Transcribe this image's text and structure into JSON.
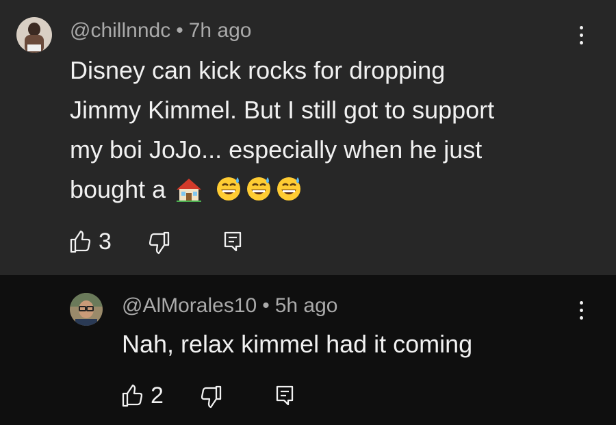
{
  "comments": [
    {
      "handle": "@chillnndc",
      "time": "7h ago",
      "text_lines": [
        "Disney can kick rocks for dropping",
        "Jimmy Kimmel. But I still got to support",
        "my boi JoJo... especially when he just",
        "bought a"
      ],
      "emoji_sequence": [
        "house-emoji",
        "grinning-sweat-emoji",
        "grinning-sweat-emoji",
        "grinning-sweat-emoji"
      ],
      "like_count": "3"
    },
    {
      "handle": "@AlMorales10",
      "time": "5h ago",
      "text": "Nah, relax kimmel had it coming",
      "like_count": "2"
    }
  ],
  "separator": "•",
  "colors": {
    "top_bg": "#272727",
    "reply_bg": "#0f0f0f",
    "text": "#f1f1f1",
    "meta": "#aaaaaa"
  }
}
